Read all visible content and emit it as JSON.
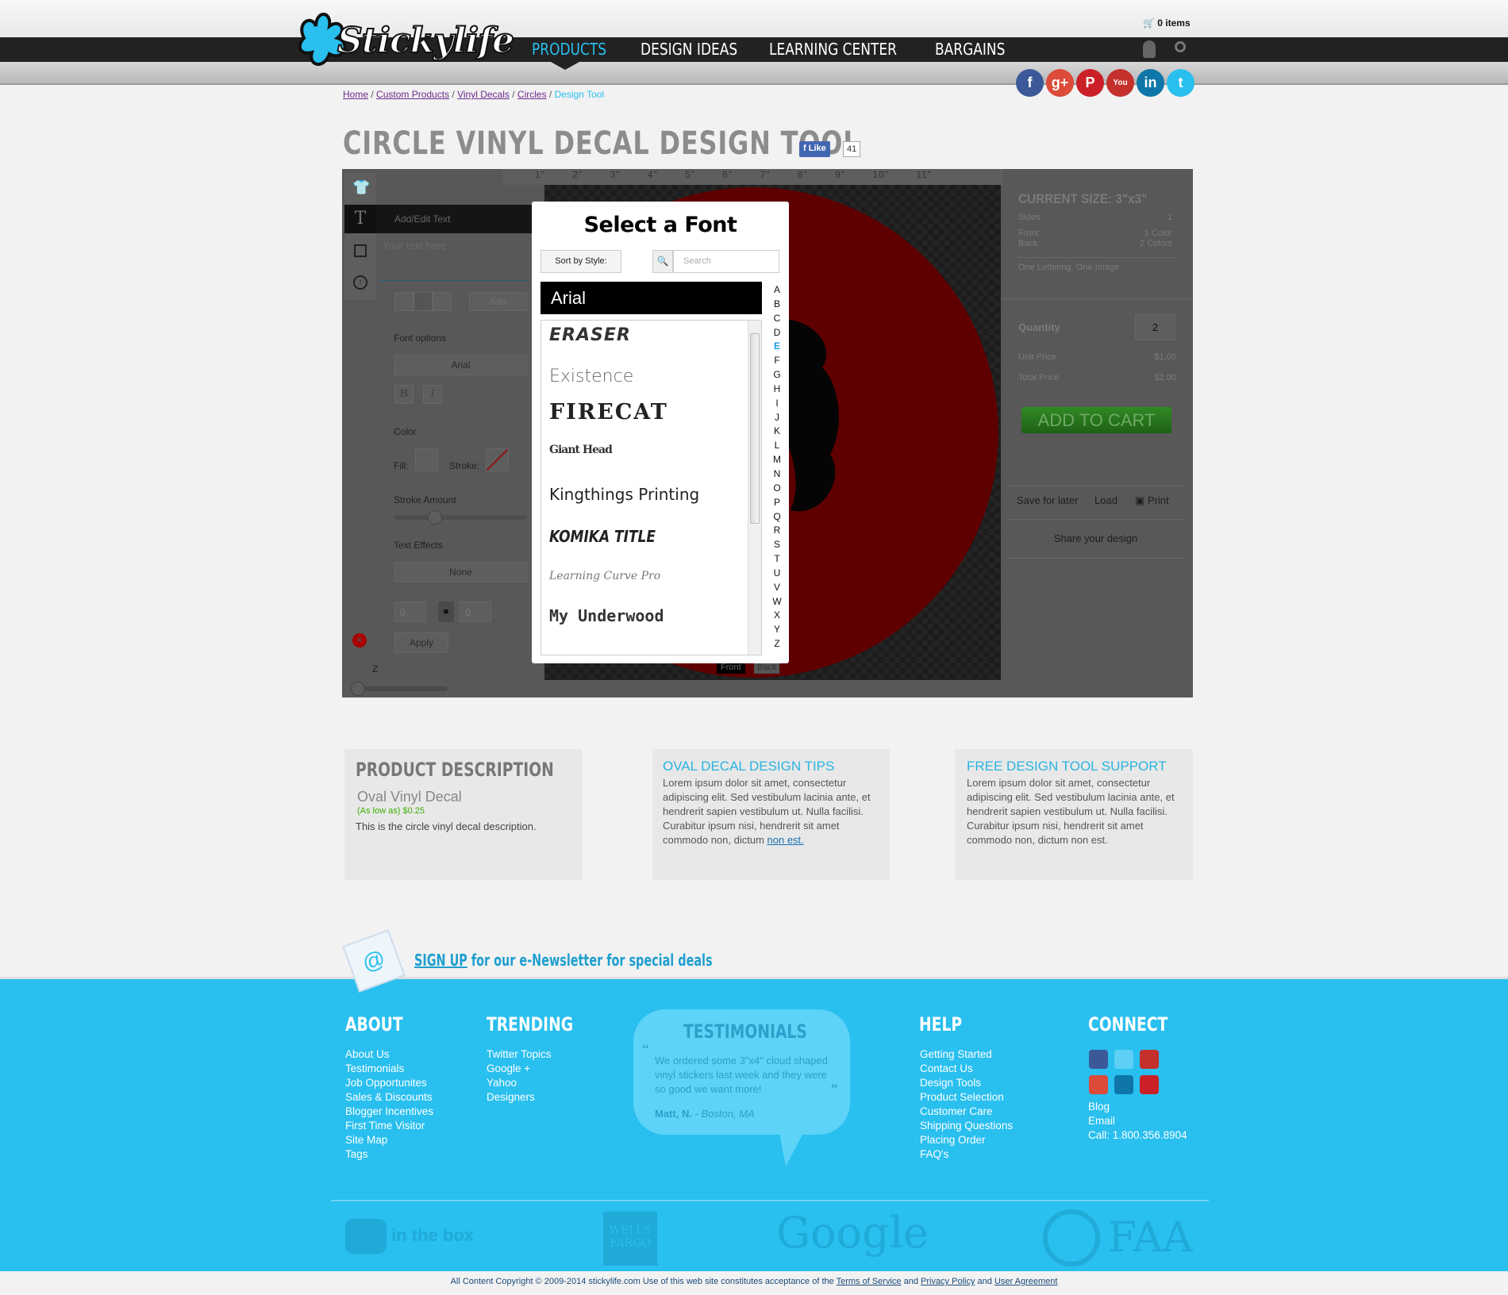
{
  "header": {
    "brand": "Stickylife",
    "cart": "0 items",
    "nav": [
      {
        "label": "PRODUCTS",
        "active": true
      },
      {
        "label": "DESIGN IDEAS"
      },
      {
        "label": "LEARNING CENTER"
      },
      {
        "label": "BARGAINS"
      }
    ],
    "social": [
      {
        "icon": "facebook-icon",
        "glyph": "f",
        "color": "#3b5998"
      },
      {
        "icon": "google-plus-icon",
        "glyph": "g+",
        "color": "#dd4b39"
      },
      {
        "icon": "pinterest-icon",
        "glyph": "P",
        "color": "#cb2027"
      },
      {
        "icon": "youtube-icon",
        "glyph": "You",
        "color": "#c4302b"
      },
      {
        "icon": "linkedin-icon",
        "glyph": "in",
        "color": "#0e76a8"
      },
      {
        "icon": "twitter-icon",
        "glyph": "t",
        "color": "#29bfef"
      }
    ]
  },
  "breadcrumb": [
    "Home",
    "Custom Products",
    "Vinyl Decals",
    "Circles",
    "Design Tool"
  ],
  "page": {
    "title": "CIRCLE VINYL DECAL DESIGN TOOL",
    "like_label": "Like",
    "like_count": "41"
  },
  "tool": {
    "ruler": "1\" 2\" 3\" 4\" 5\" 6\" 7\" 8\" 9\" 10\" 11\"",
    "panel": {
      "header": "Add/Edit Text",
      "placeholder": "Your text here",
      "add": "Add",
      "font_options": "Font options",
      "font_value": "Arial",
      "bold": "B",
      "italic": "I",
      "color": "Color",
      "fill": "Fill:",
      "stroke": "Stroke:",
      "stroke_amount": "Stroke Amount",
      "text_effects": "Text Effects",
      "effect_value": "None",
      "width": "0",
      "height": "0",
      "apply": "Apply",
      "zoom_label": "Z"
    },
    "sides": {
      "front": "Front",
      "back": "Back"
    },
    "summary": {
      "size": "CURRENT SIZE: 3\"x3\"",
      "rows": [
        [
          "Sides:",
          "1"
        ],
        [
          "Front:",
          "1 Color"
        ],
        [
          "Back:",
          "2 Colors"
        ]
      ],
      "contents": "One Lettering, One Image",
      "quantity_label": "Quantity",
      "quantity": "2",
      "unit_label": "Unit Price",
      "unit": "$1.00",
      "total_label": "Total Price",
      "total": "$2.00",
      "add_to_cart": "ADD TO CART",
      "save": "Save for later",
      "load": "Load",
      "print": "Print",
      "share": "Share your design"
    }
  },
  "font_modal": {
    "title": "Select a Font",
    "sort": "Sort by Style:",
    "search_placeholder": "Search",
    "selected": "Arial",
    "fonts": [
      "ERASER",
      "Existence",
      "FIRECAT",
      "Giant Head",
      "Kingthings Printing",
      "KOMIKA TITLE",
      "Learning Curve Pro",
      "My Underwood"
    ],
    "letters": [
      "A",
      "B",
      "C",
      "D",
      "E",
      "F",
      "G",
      "H",
      "I",
      "J",
      "K",
      "L",
      "M",
      "N",
      "O",
      "P",
      "Q",
      "R",
      "S",
      "T",
      "U",
      "V",
      "W",
      "X",
      "Y",
      "Z"
    ],
    "active_letter": "E"
  },
  "info": {
    "desc": {
      "title": "PRODUCT DESCRIPTION",
      "name": "Oval Vinyl Decal",
      "price": "(As low as) $0.25",
      "text": "This is the circle vinyl decal description."
    },
    "tips": {
      "title": "OVAL DECAL DESIGN TIPS",
      "text": "Lorem ipsum dolor sit amet, consectetur adipiscing elit. Sed vestibulum lacinia ante, et hendrerit sapien vestibulum ut. Nulla facilisi. Curabitur ipsum nisi, hendrerit sit amet commodo non, dictum ",
      "link": "non est."
    },
    "support": {
      "title": "FREE DESIGN TOOL SUPPORT",
      "text": "Lorem ipsum dolor sit amet, consectetur adipiscing elit. Sed vestibulum lacinia ante, et hendrerit sapien vestibulum ut. Nulla facilisi. Curabitur ipsum nisi, hendrerit sit amet commodo non, dictum non est."
    }
  },
  "newsletter": {
    "signup": "SIGN UP",
    "rest": " for our e-Newsletter for special deals"
  },
  "footer": {
    "about": {
      "title": "ABOUT",
      "links": [
        "About Us",
        "Testimonials",
        "Job Opportunites",
        "Sales & Discounts",
        "Blogger Incentives",
        "First Time Visitor",
        "Site Map",
        "Tags"
      ]
    },
    "trending": {
      "title": "TRENDING",
      "links": [
        "Twitter Topics",
        "Google +",
        "Yahoo",
        "Designers"
      ]
    },
    "testimonials": {
      "title": "TESTIMONIALS",
      "quote": "We ordered some 3\"x4\" cloud shaped vinyl stickers last week and they were so good we want more!",
      "author": "Matt, N.",
      "location": " - Boston, MA"
    },
    "help": {
      "title": "HELP",
      "links": [
        "Getting Started",
        "Contact Us",
        "Design Tools",
        "Product Selection",
        "Customer Care",
        "Shipping Questions",
        "Placing Order",
        "FAQ's"
      ]
    },
    "connect": {
      "title": "CONNECT",
      "links": [
        "Blog",
        "Email",
        "Call: 1.800.356.8904"
      ]
    },
    "partners": [
      "in the box",
      "WELLS FARGO",
      "Google",
      "FAA"
    ],
    "copyright": "All Content Copyright © 2009-2014 stickylife.com Use of this web site constitutes acceptance of the ",
    "terms": "Terms of Service",
    "and1": " and ",
    "privacy": "Privacy Policy",
    "and2": " and ",
    "agreement": "User Agreement"
  },
  "colors": {
    "brand_blue": "#29bfef",
    "nav_dark": "#222222",
    "cart_green": "#2f7a1f"
  }
}
